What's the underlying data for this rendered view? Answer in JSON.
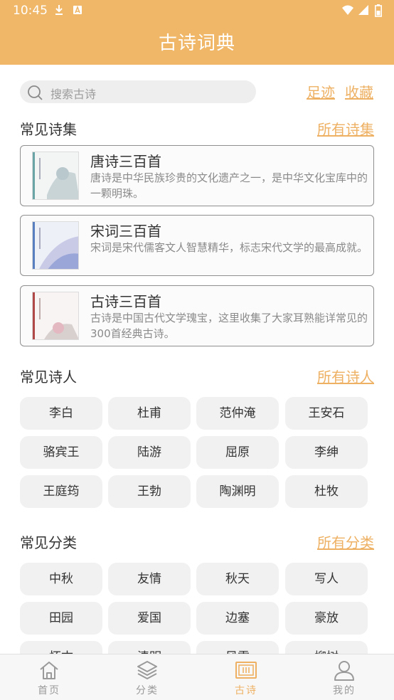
{
  "status_bar": {
    "time": "10:45"
  },
  "header": {
    "title": "古诗词典"
  },
  "search": {
    "placeholder": "搜索古诗",
    "link_footprints": "足迹",
    "link_favorites": "收藏"
  },
  "collections": {
    "title": "常见诗集",
    "more": "所有诗集",
    "items": [
      {
        "name": "唐诗三百首",
        "desc": "唐诗是中华民族珍贵的文化遗产之一，是中华文化宝库中的一颗明珠。"
      },
      {
        "name": "宋词三百首",
        "desc": "宋词是宋代儒客文人智慧精华，标志宋代文学的最高成就。"
      },
      {
        "name": "古诗三百首",
        "desc": "古诗是中国古代文学瑰宝，这里收集了大家耳熟能详常见的300首经典古诗。"
      }
    ]
  },
  "poets": {
    "title": "常见诗人",
    "more": "所有诗人",
    "items": [
      "李白",
      "杜甫",
      "范仲淹",
      "王安石",
      "骆宾王",
      "陆游",
      "屈原",
      "李绅",
      "王庭筠",
      "王勃",
      "陶渊明",
      "杜牧"
    ]
  },
  "categories": {
    "title": "常见分类",
    "more": "所有分类",
    "items": [
      "中秋",
      "友情",
      "秋天",
      "写人",
      "田园",
      "爱国",
      "边塞",
      "豪放",
      "怀古",
      "清明",
      "风雪",
      "柳树"
    ]
  },
  "bottom_nav": {
    "items": [
      {
        "label": "首页",
        "icon": "home-icon"
      },
      {
        "label": "分类",
        "icon": "layers-icon"
      },
      {
        "label": "古诗",
        "icon": "scroll-icon"
      },
      {
        "label": "我的",
        "icon": "user-icon"
      }
    ],
    "active_index": 2
  },
  "colors": {
    "accent": "#efb767",
    "link": "#eeb164",
    "chip_bg": "#f1f1f1"
  }
}
